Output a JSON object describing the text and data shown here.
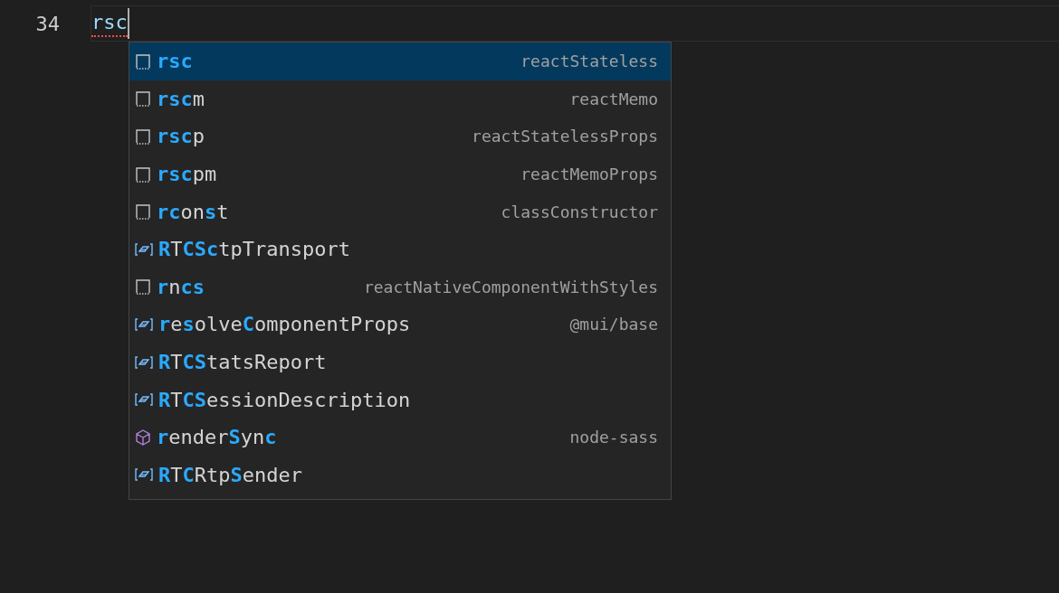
{
  "editor": {
    "line_number": "34",
    "line_text": "rsc",
    "error": true
  },
  "suggestions": [
    {
      "kind": "snippet",
      "label": "**rsc**",
      "detail": "reactStateless",
      "selected": true
    },
    {
      "kind": "snippet",
      "label": "**rsc**m",
      "detail": "reactMemo",
      "selected": false
    },
    {
      "kind": "snippet",
      "label": "**rsc**p",
      "detail": "reactStatelessProps",
      "selected": false
    },
    {
      "kind": "snippet",
      "label": "**rsc**pm",
      "detail": "reactMemoProps",
      "selected": false
    },
    {
      "kind": "snippet",
      "label": "**rc**on**s**t",
      "detail": "classConstructor",
      "selected": false
    },
    {
      "kind": "variable",
      "label": "**R**T**CSc**tpTransport",
      "selected": false
    },
    {
      "kind": "snippet",
      "label": "**r**n**cs**",
      "detail": "reactNativeComponentWithStyles",
      "selected": false
    },
    {
      "kind": "variable",
      "label": "**r**e**s**olve**C**omponentProps",
      "detail": "@mui/base",
      "selected": false
    },
    {
      "kind": "variable",
      "label": "**R**T**CS**tatsReport",
      "selected": false
    },
    {
      "kind": "variable",
      "label": "**R**T**CS**essionDescription",
      "selected": false
    },
    {
      "kind": "module",
      "label": "**r**ender**S**yn**c**",
      "detail": "node-sass",
      "selected": false
    },
    {
      "kind": "variable",
      "label": "**R**T**C**Rtp**S**ender",
      "selected": false
    }
  ]
}
